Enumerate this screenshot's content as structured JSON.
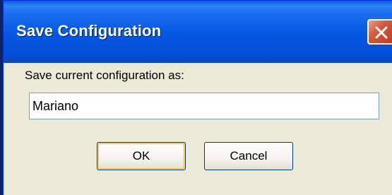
{
  "dialog": {
    "title": "Save Configuration",
    "prompt_label": "Save current configuration as:",
    "input_value": "Mariano",
    "ok_label": "OK",
    "cancel_label": "Cancel"
  },
  "icons": {
    "close": "close-icon"
  },
  "colors": {
    "titlebar": "#0556e2",
    "dialog_bg": "#ece9d8",
    "close_button": "#d7583a"
  }
}
